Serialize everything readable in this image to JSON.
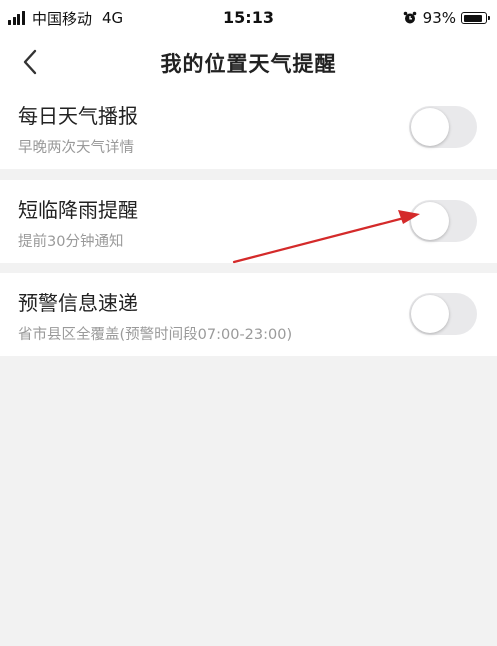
{
  "status_bar": {
    "carrier": "中国移动",
    "network": "4G",
    "time": "15:13",
    "battery": "93%",
    "battery_level": 0.93
  },
  "header": {
    "title": "我的位置天气提醒"
  },
  "settings": [
    {
      "title": "每日天气播报",
      "subtitle": "早晚两次天气详情",
      "enabled": false
    },
    {
      "title": "短临降雨提醒",
      "subtitle": "提前30分钟通知",
      "enabled": false
    },
    {
      "title": "预警信息速递",
      "subtitle": "省市县区全覆盖(预警时间段07:00-23:00)",
      "enabled": false
    }
  ],
  "colors": {
    "background": "#f2f2f2",
    "card": "#ffffff",
    "toggle_off": "#e9e9eb",
    "annotation_arrow": "#d42a2a"
  }
}
